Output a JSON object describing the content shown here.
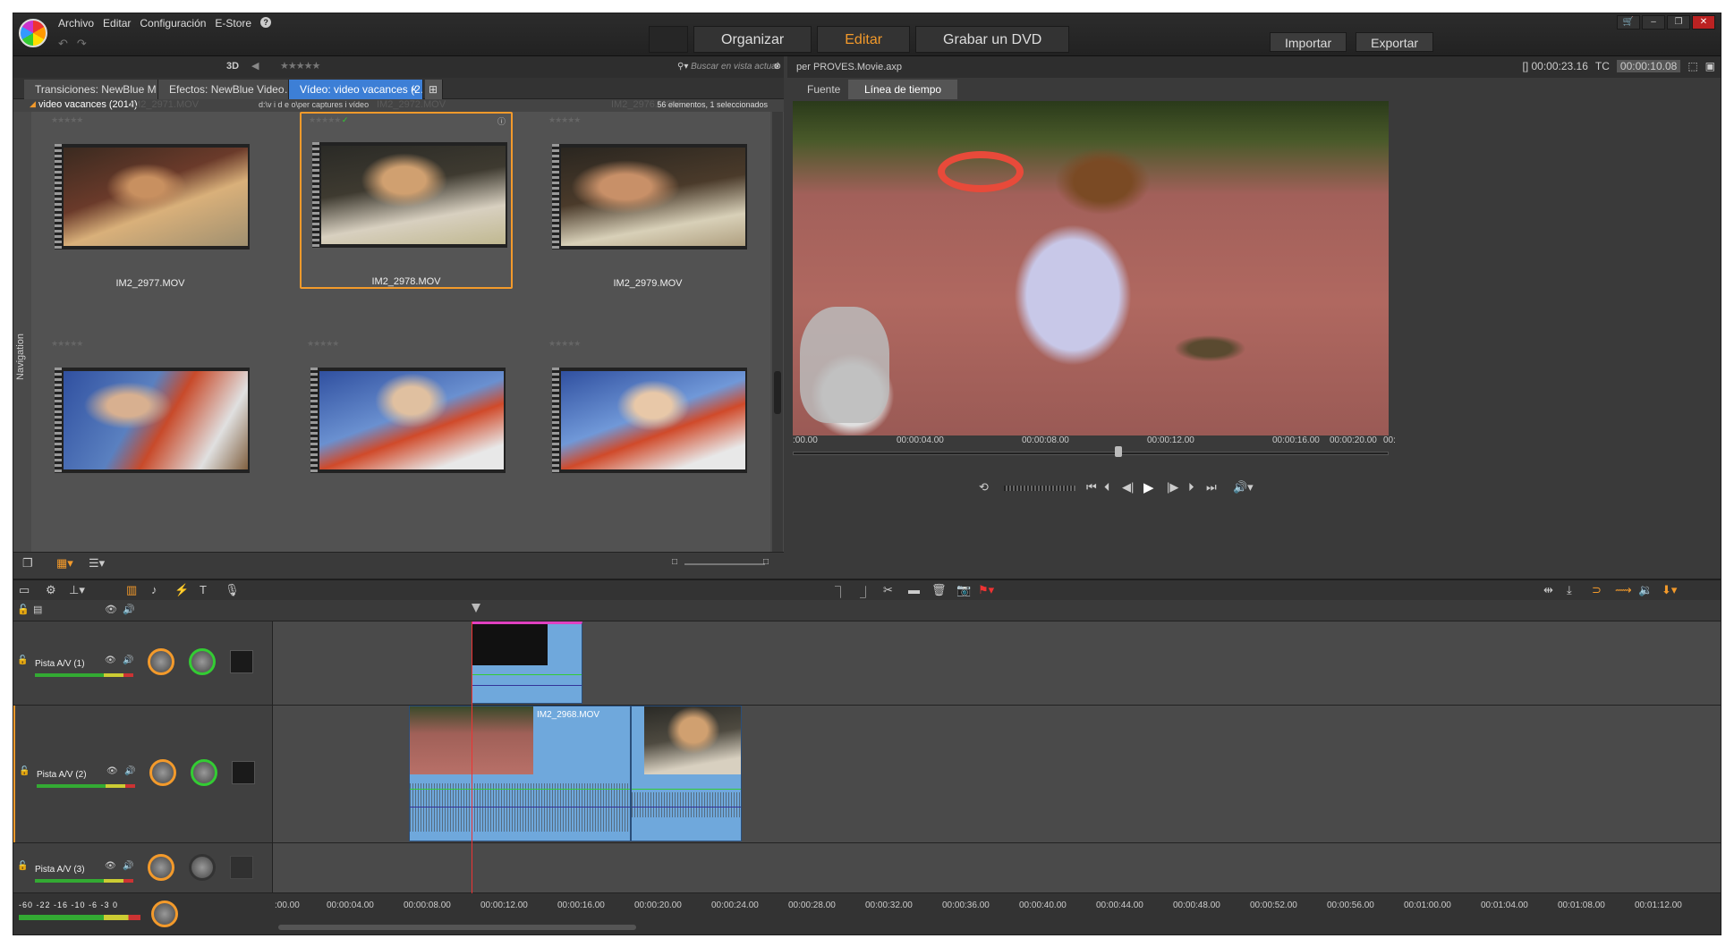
{
  "menu": [
    "Archivo",
    "Editar",
    "Configuración",
    "E-Store",
    "?"
  ],
  "modes": {
    "organize": "Organizar",
    "edit": "Editar",
    "dvd": "Grabar un DVD"
  },
  "io": {
    "import": "Importar",
    "export": "Exportar"
  },
  "library": {
    "label_3d": "3D",
    "search_placeholder": "Buscar en vista actual",
    "tabs": [
      {
        "label": "Transiciones: NewBlue M…"
      },
      {
        "label": "Efectos: NewBlue Video…"
      },
      {
        "label": "Vídeo: video vacances (2…"
      }
    ],
    "folder": "video vacances (2014)",
    "path": "d:\\v i d e o\\per captures i vídeo",
    "count": "56 elementos, 1 seleccionados",
    "ghost_names": [
      "IM2_2971.MOV",
      "IM2_2972.MOV",
      "IM2_2976.MOV"
    ],
    "nav_label": "Navigation",
    "thumbs": [
      {
        "name": "IM2_2977.MOV",
        "selected": false
      },
      {
        "name": "IM2_2978.MOV",
        "selected": true
      },
      {
        "name": "IM2_2979.MOV",
        "selected": false
      },
      {
        "name": "",
        "selected": false
      },
      {
        "name": "",
        "selected": false
      },
      {
        "name": "",
        "selected": false
      }
    ]
  },
  "player": {
    "file": "per PROVES.Movie.axp",
    "duration": "[] 00:00:23.16",
    "tc_label": "TC",
    "tc_value": "00:00:10.08",
    "tabs": [
      "Fuente",
      "Línea de tiempo"
    ],
    "ruler": [
      ":00.00",
      "00:00:04.00",
      "00:00:08.00",
      "00:00:12.00",
      "00:00:16.00",
      "00:00:20.00",
      "00:"
    ]
  },
  "timeline": {
    "tracks": [
      {
        "name": "Pista A/V (1)"
      },
      {
        "name": "Pista A/V (2)"
      },
      {
        "name": "Pista A/V (3)"
      }
    ],
    "clip_name": "IM2_2968.MOV",
    "meter_scale": "-60 -22 -16 -10 -6 -3 0",
    "ruler": [
      ":00.00",
      "00:00:04.00",
      "00:00:08.00",
      "00:00:12.00",
      "00:00:16.00",
      "00:00:20.00",
      "00:00:24.00",
      "00:00:28.00",
      "00:00:32.00",
      "00:00:36.00",
      "00:00:40.00",
      "00:00:44.00",
      "00:00:48.00",
      "00:00:52.00",
      "00:00:56.00",
      "00:01:00.00",
      "00:01:04.00",
      "00:01:08.00",
      "00:01:12.00"
    ]
  },
  "colors": {
    "accent": "#f39a2b",
    "tab_active": "#3d7fd6",
    "clip": "#6fa8dc",
    "playhead": "#e33333"
  }
}
